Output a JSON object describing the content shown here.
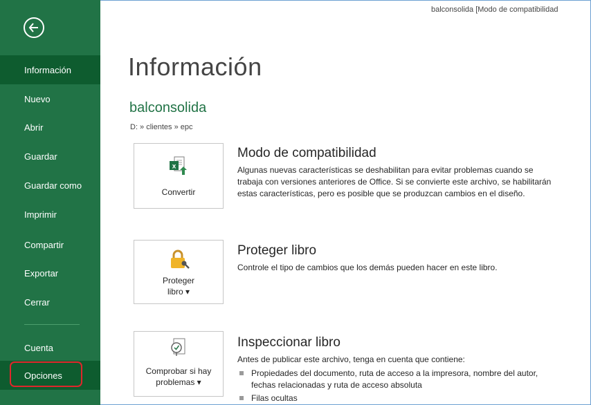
{
  "window": {
    "title": "balconsolida  [Modo de compatibilidad"
  },
  "sidebar": {
    "items": [
      {
        "label": "Información"
      },
      {
        "label": "Nuevo"
      },
      {
        "label": "Abrir"
      },
      {
        "label": "Guardar"
      },
      {
        "label": "Guardar como"
      },
      {
        "label": "Imprimir"
      },
      {
        "label": "Compartir"
      },
      {
        "label": "Exportar"
      },
      {
        "label": "Cerrar"
      },
      {
        "label": "Cuenta"
      },
      {
        "label": "Opciones"
      }
    ],
    "active": "Información",
    "accent_color": "#217346"
  },
  "main": {
    "title": "Información",
    "filename": "balconsolida",
    "path": "D: » clientes » epc",
    "sections": [
      {
        "button_label": "Convertir",
        "button_icon": "excel-convert-icon",
        "title": "Modo de compatibilidad",
        "description": "Algunas nuevas características se deshabilitan para evitar problemas cuando se trabaja con versiones anteriores de Office. Si se convierte este archivo, se habilitarán estas características, pero es posible que se produzcan cambios en el diseño."
      },
      {
        "button_label_line1": "Proteger",
        "button_label_line2": "libro ▾",
        "button_icon": "lock-key-icon",
        "title": "Proteger libro",
        "description": "Controle el tipo de cambios que los demás pueden hacer en este libro."
      },
      {
        "button_label_line1": "Comprobar si hay",
        "button_label_line2": "problemas ▾",
        "button_icon": "inspect-document-icon",
        "title": "Inspeccionar libro",
        "description": "Antes de publicar este archivo, tenga en cuenta que contiene:",
        "bullets": [
          "Propiedades del documento, ruta de acceso a la impresora, nombre del autor, fechas relacionadas y ruta de acceso absoluta",
          "Filas ocultas"
        ]
      }
    ]
  }
}
